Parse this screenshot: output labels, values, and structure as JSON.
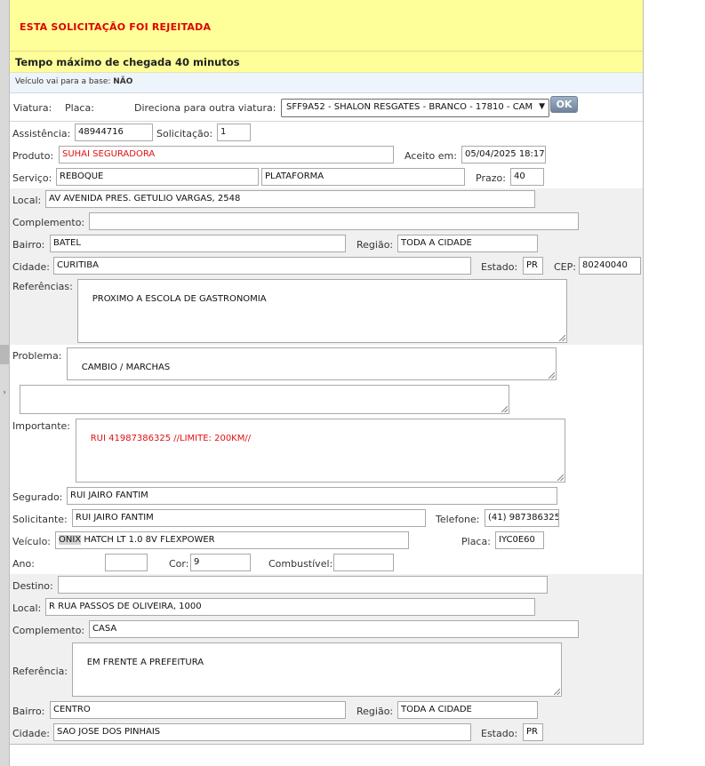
{
  "banner": {
    "rejected_text": "ESTA SOLICITAÇÃO FOI REJEITADA"
  },
  "header": {
    "max_arrival": "Tempo máximo de chegada 40 minutos"
  },
  "base_info": {
    "label": "Veículo vai para a base:",
    "value": "NÃO"
  },
  "viatura_row": {
    "viatura_label": "Viatura:",
    "placa_label": "Placa:",
    "redirect_label": "Direciona para outra viatura:",
    "selected_viatura": "SFF9A52 - SHALON RESGATES - BRANCO - 17810 - CAM",
    "ok_label": "OK"
  },
  "service": {
    "assistencia_label": "Assistência:",
    "assistencia": "48944716",
    "solicitacao_label": "Solicitação:",
    "solicitacao": "1",
    "produto_label": "Produto:",
    "produto": "SUHAI SEGURADORA",
    "aceito_label": "Aceito em:",
    "aceito": "05/04/2025 18:17",
    "servico_label": "Serviço:",
    "servico": "REBOQUE",
    "servico_tipo": "PLATAFORMA",
    "prazo_label": "Prazo:",
    "prazo": "40"
  },
  "origem": {
    "local_label": "Local:",
    "local": "AV AVENIDA PRES. GETULIO VARGAS, 2548",
    "complemento_label": "Complemento:",
    "complemento": "",
    "bairro_label": "Bairro:",
    "bairro": "BATEL",
    "regiao_label": "Região:",
    "regiao": "TODA A CIDADE",
    "cidade_label": "Cidade:",
    "cidade": "CURITIBA",
    "estado_label": "Estado:",
    "estado": "PR",
    "cep_label": "CEP:",
    "cep": "80240040",
    "referencias_label": "Referências:",
    "referencias": "PROXIMO A ESCOLA DE GASTRONOMIA"
  },
  "problema": {
    "label": "Problema:",
    "value": "CAMBIO / MARCHAS",
    "extra": "",
    "importante_label": "Importante:",
    "importante": "RUI 41987386325 //LIMITE: 200KM//"
  },
  "cliente": {
    "segurado_label": "Segurado:",
    "segurado": "RUI JAIRO FANTIM",
    "solicitante_label": "Solicitante:",
    "solicitante": "RUI JAIRO FANTIM",
    "telefone_label": "Telefone:",
    "telefone": "(41) 987386325",
    "veiculo_label": "Veículo:",
    "veiculo_hl": "ONIX",
    "veiculo_rest": " HATCH LT 1.0 8V FLEXPOWER",
    "placa_label": "Placa:",
    "placa": "IYC0E60",
    "ano_label": "Ano:",
    "ano": "",
    "cor_label": "Cor:",
    "cor": "9",
    "combustivel_label": "Combustível:",
    "combustivel": ""
  },
  "destino": {
    "destino_label": "Destino:",
    "destino": "",
    "local_label": "Local:",
    "local": "R RUA PASSOS DE OLIVEIRA, 1000",
    "complemento_label": "Complemento:",
    "complemento": "CASA",
    "referencia_label": "Referência:",
    "referencia": "EM FRENTE A PREFEITURA",
    "bairro_label": "Bairro:",
    "bairro": "CENTRO",
    "regiao_label": "Região:",
    "regiao": "TODA A CIDADE",
    "cidade_label": "Cidade:",
    "cidade": "SAO JOSE DOS PINHAIS",
    "estado_label": "Estado:",
    "estado": "PR"
  },
  "colors": {
    "alert_red": "#e00000",
    "banner_yellow": "#ffff99",
    "info_blue": "#eef4fb",
    "section_gray": "#f0f0f0"
  }
}
